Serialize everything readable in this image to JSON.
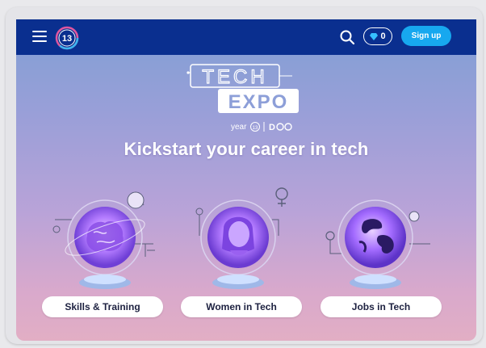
{
  "header": {
    "logo_text": "13",
    "gem_count": "0",
    "signup_label": "Sign up"
  },
  "hero": {
    "logo_line1": "TECH",
    "logo_line2": "EXPO",
    "logo_sub_left": "year",
    "logo_sub_num": "13",
    "logo_sub_right": "D",
    "heading": "Kickstart your career in tech"
  },
  "categories": [
    {
      "label": "Skills & Training",
      "icon": "brain-orb-icon"
    },
    {
      "label": "Women in Tech",
      "icon": "woman-orb-icon"
    },
    {
      "label": "Jobs in Tech",
      "icon": "globe-orb-icon"
    }
  ],
  "colors": {
    "nav_bg": "#0a2f8f",
    "accent": "#17a8ef",
    "orb": "#a96bff"
  }
}
